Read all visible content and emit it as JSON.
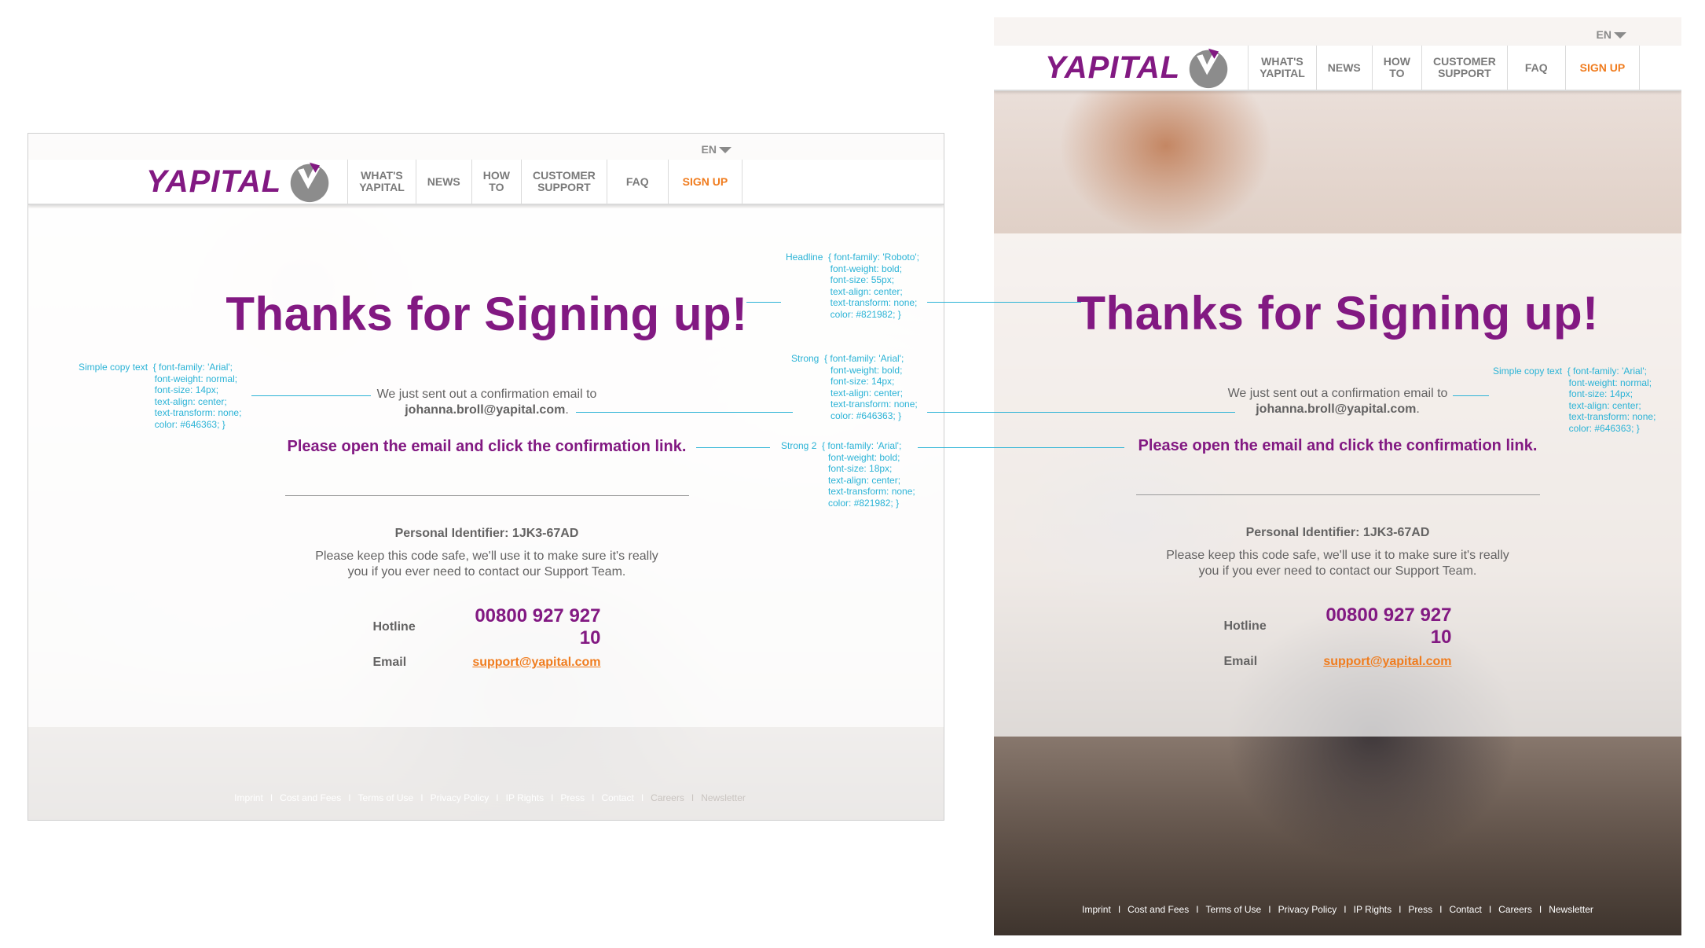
{
  "brand": {
    "name": "YAPITAL",
    "purple": "#821982",
    "orange": "#f07c1e",
    "text_grey": "#646363",
    "annotation_blue": "#2bb3d6"
  },
  "header": {
    "language": "EN",
    "nav": [
      {
        "label": "WHAT'S\nYAPITAL"
      },
      {
        "label": "NEWS"
      },
      {
        "label": "HOW\nTO"
      },
      {
        "label": "CUSTOMER\nSUPPORT"
      },
      {
        "label": "FAQ"
      },
      {
        "label": "SIGN UP"
      }
    ]
  },
  "main": {
    "headline": "Thanks for Signing up!",
    "sent_text": "We just sent out a confirmation email to",
    "email_address": "johanna.broll@yapital.com",
    "email_period": ".",
    "instruction": "Please open the email and click the confirmation link.",
    "personal_identifier": "Personal Identifier: 1JK3-67AD",
    "keep_safe_line1": "Please keep this code safe, we'll use it to make sure it's really",
    "keep_safe_line2": "you if you ever need to contact our Support Team.",
    "hotline_label": "Hotline",
    "hotline_number": "00800 927 927 10",
    "email_label": "Email",
    "support_email": "support@yapital.com"
  },
  "footer": {
    "links": [
      "Imprint",
      "Cost and Fees",
      "Terms of Use",
      "Privacy Policy",
      "IP Rights",
      "Press",
      "Contact",
      "Careers",
      "Newsletter"
    ]
  },
  "annotations": {
    "headline": "Headline  { font-family: 'Roboto';\n                 font-weight: bold;\n                 font-size: 55px;\n                 text-align: center;\n                 text-transform: none;\n                 color: #821982; }",
    "simple_copy": "Simple copy text  { font-family: 'Arial';\n                             font-weight: normal;\n                             font-size: 14px;\n                             text-align: center;\n                             text-transform: none;\n                             color: #646363; }",
    "strong": "Strong  { font-family: 'Arial';\n               font-weight: bold;\n               font-size: 14px;\n               text-align: center;\n               text-transform: none;\n               color: #646363; }",
    "strong2": "Strong 2  { font-family: 'Arial';\n                  font-weight: bold;\n                  font-size: 18px;\n                  text-align: center;\n                  text-transform: none;\n                  color: #821982; }"
  }
}
